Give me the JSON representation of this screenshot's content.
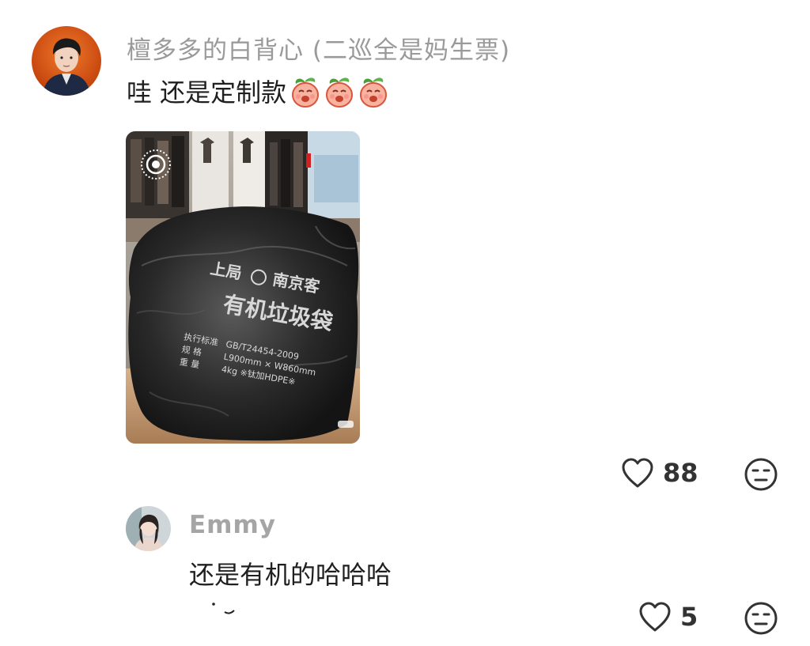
{
  "main_comment": {
    "username": "檀多多的白背心 (二巡全是妈生票)",
    "text": "哇 还是定制款",
    "emoji": "peach-laugh-emoji",
    "emoji_count": 3,
    "likes": "88",
    "photo": {
      "bag_lines": [
        "上局",
        "南京客",
        "有机垃圾袋"
      ],
      "spec_labels": [
        "执行标准",
        "规  格",
        "重  量"
      ],
      "spec_values": [
        "GB/T24454-2009",
        "L900mm × W860mm",
        "4kg ※钛加HDPE※"
      ]
    }
  },
  "reply": {
    "username": "Emmy",
    "text": "还是有机的哈哈哈",
    "likes": "5"
  },
  "colors": {
    "username": "#9a9a9a",
    "text": "#1f1f1f",
    "icon": "#333333"
  }
}
